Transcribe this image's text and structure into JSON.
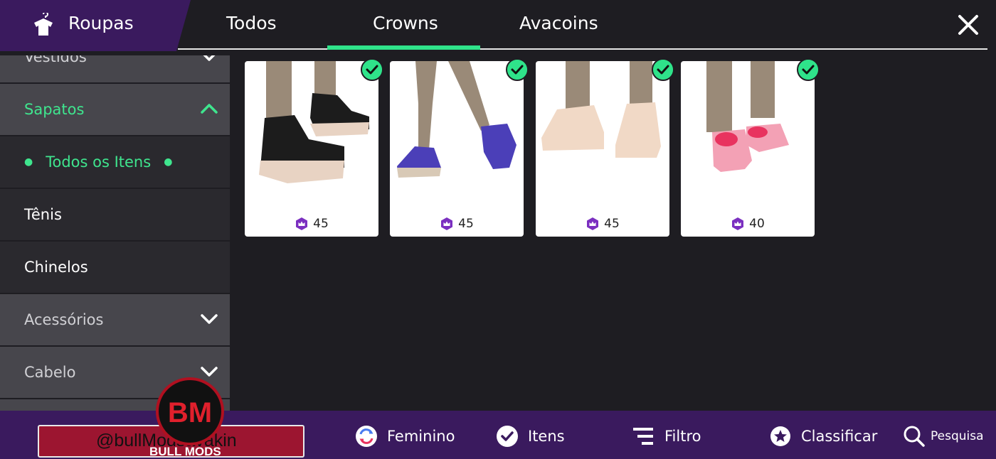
{
  "header": {
    "title": "Roupas",
    "tabs": [
      {
        "label": "Todos"
      },
      {
        "label": "Crowns"
      },
      {
        "label": "Avacoins"
      }
    ],
    "active_tab": "Crowns",
    "accent_color": "#2fe38a"
  },
  "sidebar": {
    "items": [
      {
        "label": "Vestidos",
        "state": "collapsed"
      },
      {
        "label": "Sapatos",
        "state": "expanded"
      },
      {
        "label": "Todos os Itens",
        "state": "selected"
      },
      {
        "label": "Tênis"
      },
      {
        "label": "Chinelos"
      },
      {
        "label": "Acessórios",
        "state": "collapsed"
      },
      {
        "label": "Cabelo",
        "state": "collapsed"
      }
    ]
  },
  "items": [
    {
      "price": "45",
      "owned": true,
      "icon": "black-white-sneakers"
    },
    {
      "price": "45",
      "owned": true,
      "icon": "purple-sneakers"
    },
    {
      "price": "45",
      "owned": true,
      "icon": "beige-sneakers"
    },
    {
      "price": "40",
      "owned": true,
      "icon": "pink-fur-slides"
    }
  ],
  "bottom_bar": {
    "watermark": "@bullModsavakin",
    "logo_text": "BM",
    "logo_sub": "BULL MODS",
    "gender": "Feminino",
    "items": "Itens",
    "filter": "Filtro",
    "sort": "Classificar",
    "search": "Pesquisa"
  }
}
